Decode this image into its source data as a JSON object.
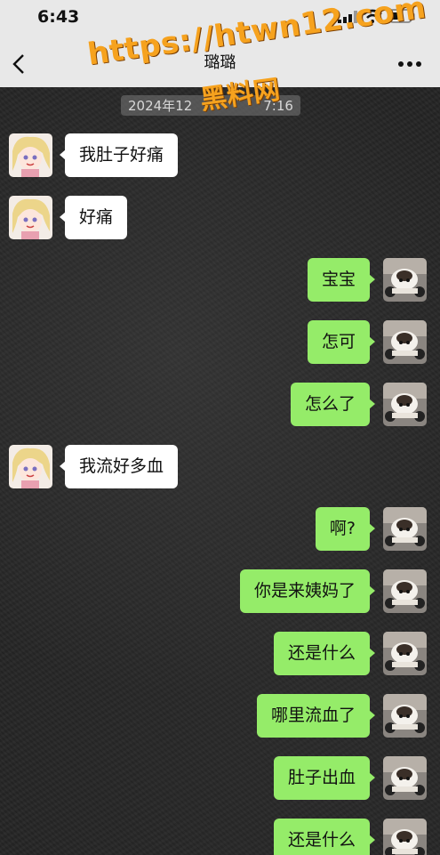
{
  "status_bar": {
    "time": "6:43",
    "icons": [
      "signal-icon",
      "wifi-icon",
      "battery-icon"
    ]
  },
  "nav": {
    "title": "璐璐",
    "back_icon": "chevron-left-icon",
    "more_icon": "more-dots-icon"
  },
  "timestamp": "2024年12",
  "timestamp_tail": "7:16",
  "watermark": {
    "url": "https://htwn12.com",
    "site": "黑料网"
  },
  "messages": [
    {
      "side": "left",
      "text": "我肚子好痛"
    },
    {
      "side": "left",
      "text": "好痛"
    },
    {
      "side": "right",
      "text": "宝宝"
    },
    {
      "side": "right",
      "text": "怎可"
    },
    {
      "side": "right",
      "text": "怎么了"
    },
    {
      "side": "left",
      "text": "我流好多血"
    },
    {
      "side": "right",
      "text": "啊?"
    },
    {
      "side": "right",
      "text": "你是来姨妈了"
    },
    {
      "side": "right",
      "text": "还是什么"
    },
    {
      "side": "right",
      "text": "哪里流血了"
    },
    {
      "side": "right",
      "text": "肚子出血"
    },
    {
      "side": "right",
      "text": "还是什么"
    }
  ],
  "colors": {
    "sent_bubble": "#95ec69",
    "received_bubble": "#ffffff",
    "header_bg": "#e8e8e8",
    "watermark": "#f6a21e"
  }
}
